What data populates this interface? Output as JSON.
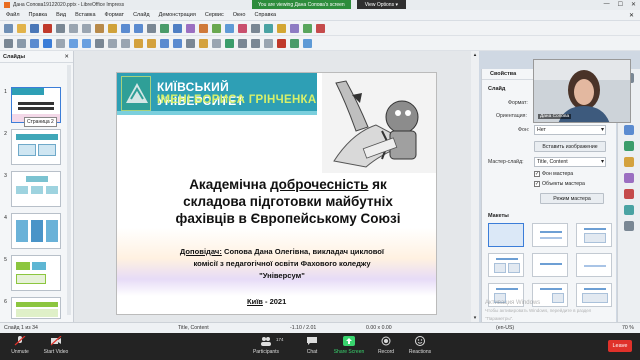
{
  "window": {
    "title": "Дана Сопова19122020.pptx - LibreOffice Impress"
  },
  "zoom_banner": {
    "sharing_text": "You are viewing Дана Сопова's screen",
    "view_options": "View Options ▾"
  },
  "menu": [
    "Файл",
    "Правка",
    "Вид",
    "Вставка",
    "Формат",
    "Слайд",
    "Демонстрация",
    "Сервис",
    "Окно",
    "Справка"
  ],
  "slides_panel": {
    "title": "Слайды",
    "tooltip": "Страница 2",
    "numbers": [
      "1",
      "2",
      "3",
      "4",
      "5",
      "6"
    ]
  },
  "slide": {
    "university_line1": "КИЇВСЬКИЙ УНІВЕРСИТЕТ",
    "university_line2": "ІМЕНІ БОРИСА ГРІНЧЕНКА",
    "title_pre": "Академічна ",
    "title_underlined": "доброчесність",
    "title_post": " як підготовки майбутніх фахівців в Європейському Союзі",
    "title_line1a": "Академічна ",
    "title_line1b": "доброчесність",
    "title_line1c": " як",
    "title_line2": "складова підготовки майбутніх",
    "title_line3": "фахівців в Європейському Союзі",
    "speaker_label": "Доповідач:",
    "speaker_text": " Сопова Дана Олегівна, викладач циклової",
    "speaker_line2": "комісії з педагогічної освіти Фахового коледжу",
    "speaker_line3": "\"Універсум\"",
    "city": "Київ",
    "year": " - 2021"
  },
  "properties": {
    "title": "Свойства",
    "section_slide": "Слайд",
    "format_label": "Формат:",
    "orientation_label": "Ориентация:",
    "background_label": "Фон:",
    "background_value": "Нет",
    "insert_image_btn": "Вставить изображение",
    "master_label": "Мастер-слайд:",
    "master_value": "Title, Content",
    "check_bg": "Фон мастера",
    "check_objects": "Объекты мастера",
    "master_mode_btn": "Режим мастера",
    "section_layouts": "Макеты"
  },
  "webcam": {
    "name": "Дана Сопова"
  },
  "statusbar": {
    "slide_of": "Слайд 1 из 34",
    "layout": "Title, Content",
    "position": "-1.10 / 2.01",
    "size": "0.00 x 0.00",
    "lang": "(en-US)",
    "zoom": "70 %"
  },
  "watermark": {
    "line1": "Активация Windows",
    "line2": "Чтобы активировать Windows, перейдите в раздел \"Параметры\"."
  },
  "zoom_toolbar": {
    "unmute": "Unmute",
    "start_video": "Start Video",
    "participants": "Participants",
    "participants_count": "174",
    "chat": "Chat",
    "share_screen": "Share Screen",
    "record": "Record",
    "reactions": "Reactions",
    "leave": "Leave"
  }
}
